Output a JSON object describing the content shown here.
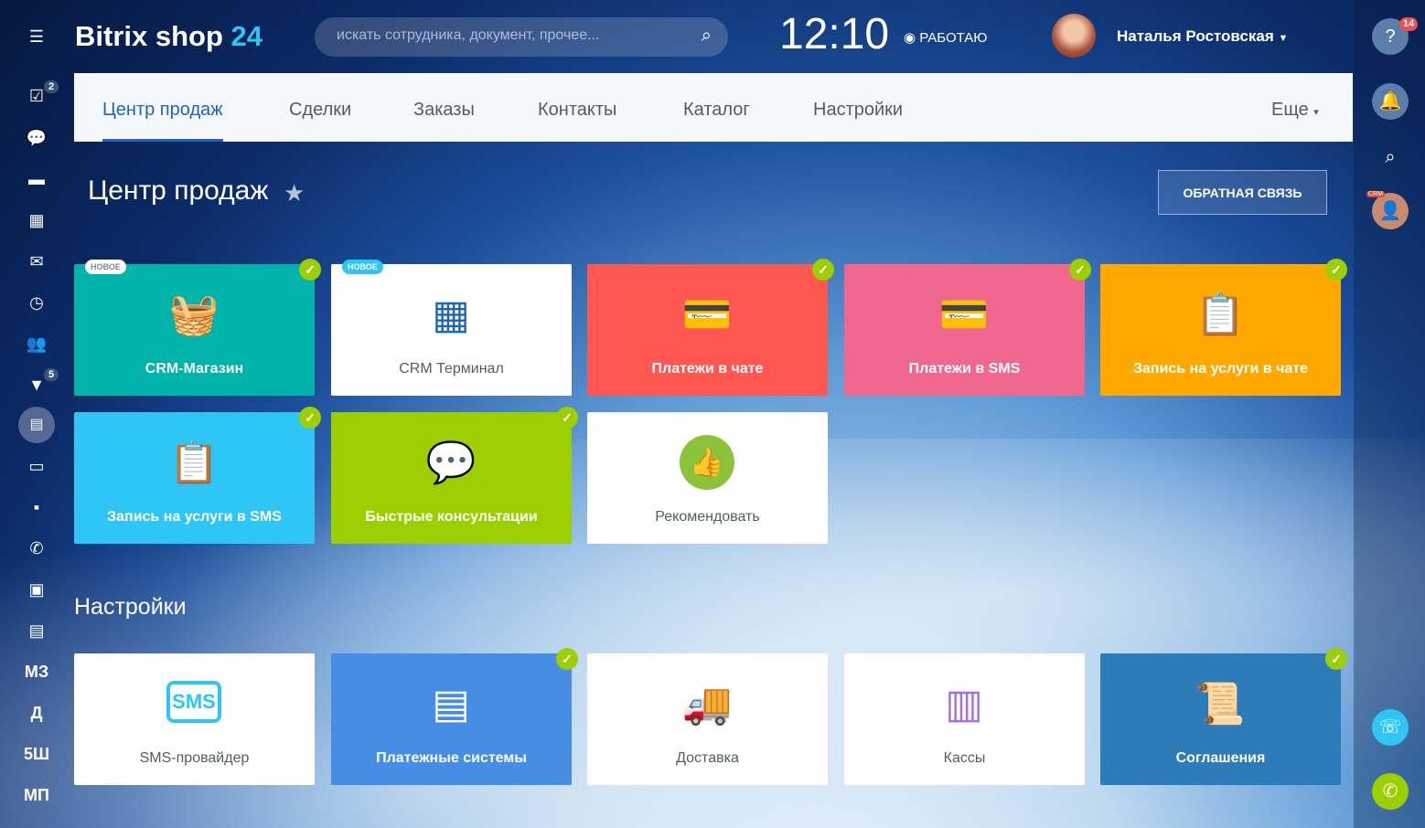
{
  "header": {
    "logo_main": "Bitrix shop",
    "logo_num": "24",
    "search_placeholder": "искать сотрудника, документ, прочее...",
    "clock": "12:10",
    "status": "РАБОТАЮ",
    "user": "Наталья Ростовская"
  },
  "left_sidebar": {
    "tasks_badge": "2",
    "crm_badge": "5",
    "text_items": [
      "МЗ",
      "Д",
      "5Ш",
      "МП"
    ]
  },
  "tabs": [
    "Центр продаж",
    "Сделки",
    "Заказы",
    "Контакты",
    "Каталог",
    "Настройки"
  ],
  "tabs_more": "Еще",
  "page_title": "Центр продаж",
  "feedback_button": "ОБРАТНАЯ СВЯЗЬ",
  "settings_title": "Настройки",
  "tiles": [
    {
      "label": "CRM-Магазин",
      "color": "#00b4ac",
      "icon": "basket-icon",
      "checked": true,
      "badge": "НОВОЕ"
    },
    {
      "label": "CRM Терминал",
      "color": "#ffffff",
      "icon": "terminal-icon",
      "checked": false,
      "badge": "НОВОЕ"
    },
    {
      "label": "Платежи в чате",
      "color": "#ff5752",
      "icon": "chat-payment-icon",
      "checked": true
    },
    {
      "label": "Платежи в SMS",
      "color": "#f0688d",
      "icon": "sms-payment-icon",
      "checked": true
    },
    {
      "label": "Запись на услуги в чате",
      "color": "#ffa900",
      "icon": "chat-booking-icon",
      "checked": true
    },
    {
      "label": "Запись на услуги в SMS",
      "color": "#2fc6f6",
      "icon": "sms-booking-icon",
      "checked": true
    },
    {
      "label": "Быстрые консультации",
      "color": "#9dcf00",
      "icon": "chat-icon",
      "checked": true
    },
    {
      "label": "Рекомендовать",
      "color": "#ffffff",
      "icon": "thumbs-up-icon",
      "checked": false
    }
  ],
  "settings_tiles": [
    {
      "label": "SMS-провайдер",
      "color": "#ffffff",
      "icon": "sms-icon",
      "checked": false
    },
    {
      "label": "Платежные системы",
      "color": "#468ee5",
      "icon": "payment-systems-icon",
      "checked": true
    },
    {
      "label": "Доставка",
      "color": "#ffffff",
      "icon": "truck-icon",
      "checked": false
    },
    {
      "label": "Кассы",
      "color": "#ffffff",
      "icon": "cash-register-icon",
      "checked": false
    },
    {
      "label": "Соглашения",
      "color": "#2d7bb8",
      "icon": "agreement-icon",
      "checked": true
    }
  ],
  "right_panel": {
    "help_badge": "14",
    "crm_label": "CRM"
  }
}
